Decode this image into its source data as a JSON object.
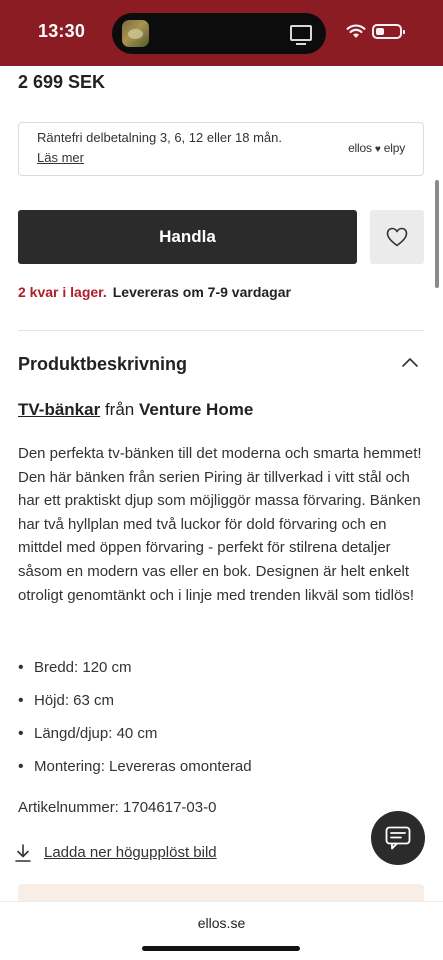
{
  "status_bar": {
    "time": "13:30",
    "island_thumbnail_icon": "photo-thumbnail-icon",
    "island_screen_icon": "screen-mirroring-icon",
    "wifi_icon": "wifi-icon",
    "battery_icon": "battery-low-icon",
    "background_color": "#8b1c24"
  },
  "product": {
    "price": "2 699 SEK"
  },
  "installment": {
    "text": "Räntefri delbetalning 3, 6, 12 eller 18 mån.",
    "link_label": "Läs mer",
    "partner_left": "ellos",
    "partner_right": "elpy",
    "partner_heart": "♥"
  },
  "buy": {
    "button_label": "Handla",
    "wishlist_icon": "heart-icon",
    "button_color": "#2b2b2b"
  },
  "stock": {
    "availability": "2 kvar i lager.",
    "delivery": "Levereras om 7-9 vardagar",
    "availability_color": "#b01e2a"
  },
  "description_section": {
    "title": "Produktbeskrivning",
    "collapse_icon": "chevron-up-icon",
    "category_link": "TV-bänkar",
    "from_word": "från",
    "brand": "Venture Home",
    "body": "Den perfekta tv-bänken till det moderna och smarta hemmet! Den här bänken från serien Piring är tillverkad i vitt stål och har ett praktiskt djup som möjliggör massa förvaring. Bänken har två hyllplan med två luckor för dold förvaring och en mittdel med öppen förvaring - perfekt för stilrena detaljer såsom en modern vas eller en bok. Designen är helt enkelt otroligt genomtänkt och i linje med trenden likväl som tidlös!",
    "specs": [
      "Bredd: 120 cm",
      "Höjd: 63 cm",
      "Längd/djup: 40 cm",
      "Montering: Levereras omonterad"
    ],
    "article_number": "Artikelnummer: 1704617-03-0",
    "download_icon": "download-icon",
    "download_label": "Ladda ner högupplöst bild"
  },
  "chat": {
    "icon": "chat-bubble-icon"
  },
  "browser": {
    "url": "ellos.se"
  }
}
